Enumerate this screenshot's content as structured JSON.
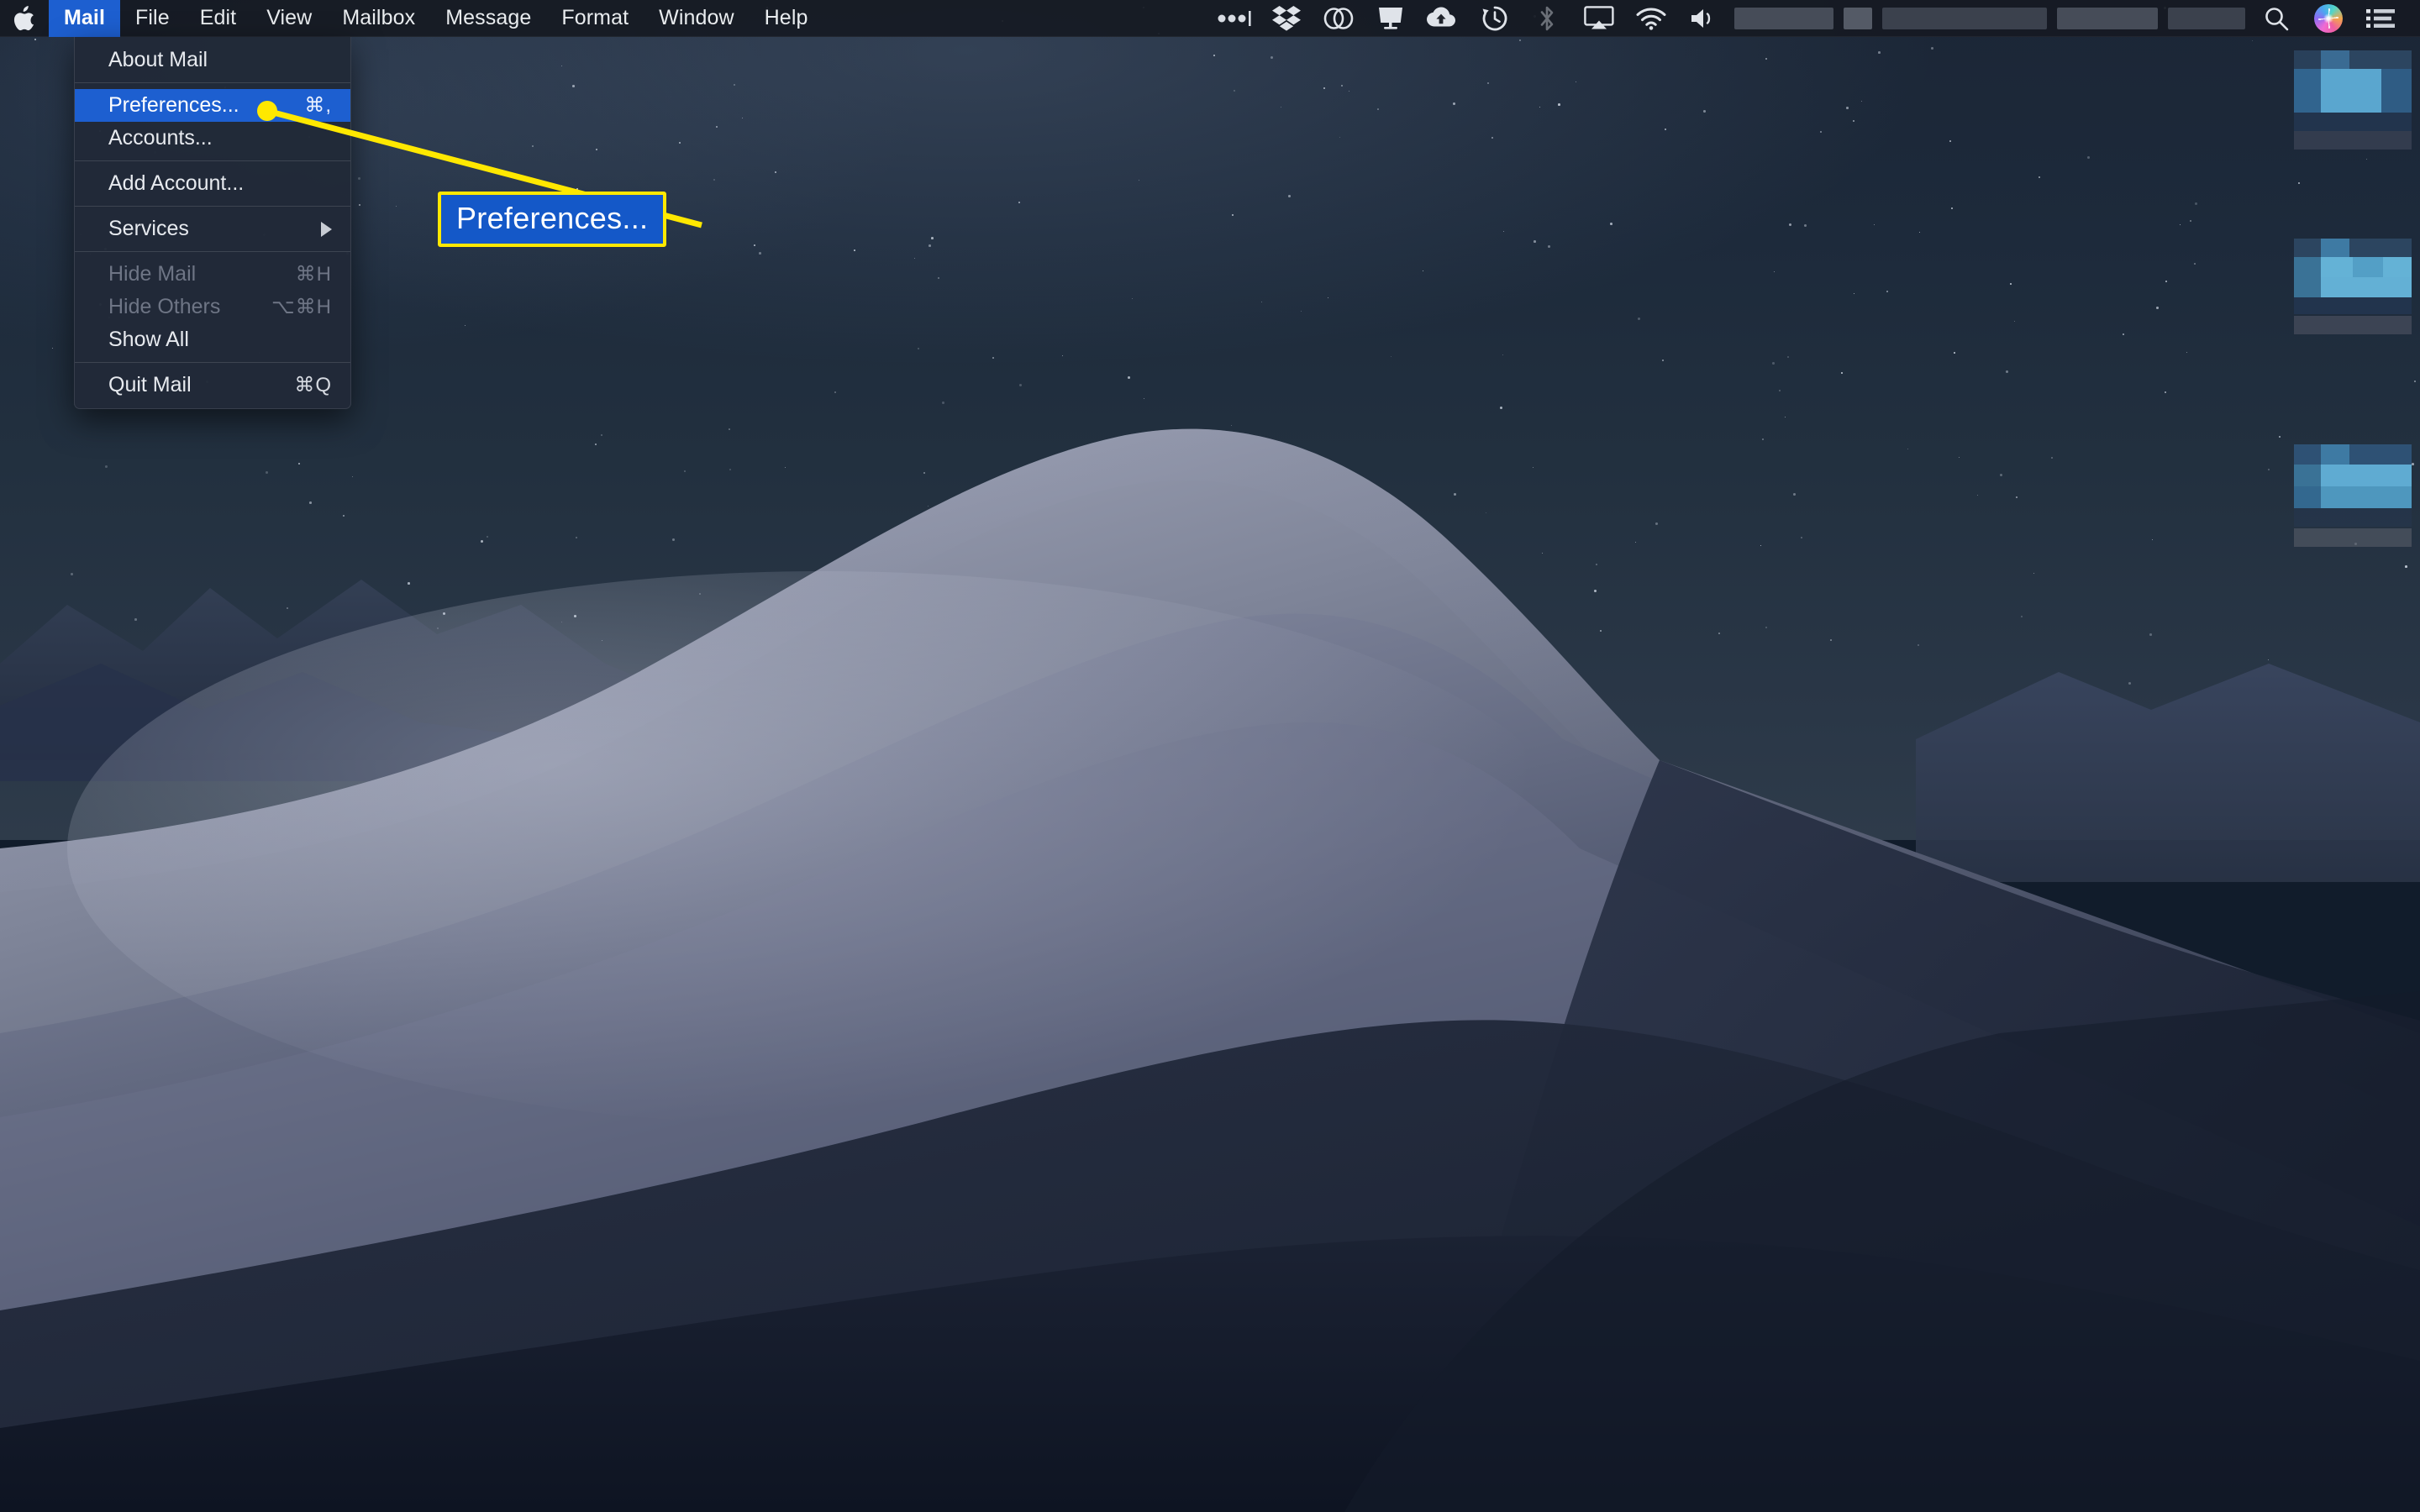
{
  "menubar": {
    "apple_icon": "apple-logo-icon",
    "items": [
      {
        "label": "Mail",
        "active": true
      },
      {
        "label": "File",
        "active": false
      },
      {
        "label": "Edit",
        "active": false
      },
      {
        "label": "View",
        "active": false
      },
      {
        "label": "Mailbox",
        "active": false
      },
      {
        "label": "Message",
        "active": false
      },
      {
        "label": "Format",
        "active": false
      },
      {
        "label": "Window",
        "active": false
      },
      {
        "label": "Help",
        "active": false
      }
    ],
    "status_icons": [
      {
        "name": "bartender-dots-icon",
        "dim": false
      },
      {
        "name": "dropbox-icon",
        "dim": false
      },
      {
        "name": "adobe-creative-cloud-icon",
        "dim": false
      },
      {
        "name": "display-screen-icon",
        "dim": false
      },
      {
        "name": "cloud-upload-icon",
        "dim": false
      },
      {
        "name": "time-machine-icon",
        "dim": false
      },
      {
        "name": "bluetooth-icon",
        "dim": true
      },
      {
        "name": "airplay-icon",
        "dim": false
      },
      {
        "name": "wifi-icon",
        "dim": false
      },
      {
        "name": "volume-icon",
        "dim": false
      }
    ],
    "redacted_blocks": [
      {
        "width": 118,
        "shade": "d1"
      },
      {
        "width": 34,
        "shade": "d3"
      },
      {
        "width": 196,
        "shade": "d2"
      },
      {
        "width": 120,
        "shade": "d1"
      },
      {
        "width": 92,
        "shade": "d2"
      }
    ],
    "right_icons": [
      {
        "name": "spotlight-search-icon"
      },
      {
        "name": "siri-icon"
      },
      {
        "name": "control-center-list-icon"
      }
    ]
  },
  "mail_menu": {
    "owner": "Mail",
    "groups": [
      {
        "items": [
          {
            "label": "About Mail",
            "shortcut": "",
            "state": "normal",
            "submenu": false
          }
        ]
      },
      {
        "items": [
          {
            "label": "Preferences...",
            "shortcut": "⌘,",
            "state": "selected",
            "submenu": false
          },
          {
            "label": "Accounts...",
            "shortcut": "",
            "state": "normal",
            "submenu": false
          }
        ]
      },
      {
        "items": [
          {
            "label": "Add Account...",
            "shortcut": "",
            "state": "normal",
            "submenu": false
          }
        ]
      },
      {
        "items": [
          {
            "label": "Services",
            "shortcut": "",
            "state": "normal",
            "submenu": true
          }
        ]
      },
      {
        "items": [
          {
            "label": "Hide Mail",
            "shortcut": "⌘H",
            "state": "disabled",
            "submenu": false
          },
          {
            "label": "Hide Others",
            "shortcut": "⌥⌘H",
            "state": "disabled",
            "submenu": false
          },
          {
            "label": "Show All",
            "shortcut": "",
            "state": "normal",
            "submenu": false
          }
        ]
      },
      {
        "items": [
          {
            "label": "Quit Mail",
            "shortcut": "⌘Q",
            "state": "normal",
            "submenu": false
          }
        ]
      }
    ]
  },
  "annotation": {
    "callout_label": "Preferences...",
    "line_color": "#ffe800",
    "box_fill": "#1458c8",
    "box_border": "#ffe800",
    "dot_target": "Preferences... menu item"
  },
  "desktop": {
    "wallpaper_name": "mojave-night-dune-wallpaper",
    "icons": [
      {
        "name": "desktop-icon-1",
        "label_redacted": true
      },
      {
        "name": "desktop-icon-2",
        "label_redacted": true
      },
      {
        "name": "desktop-icon-3",
        "label_redacted": true
      }
    ]
  },
  "colors": {
    "accent_blue": "#1d5fd0",
    "menubar_bg": "#161a22",
    "menu_bg": "#212938",
    "annotation_yellow": "#ffe800",
    "text_primary": "#e7eaef",
    "text_disabled": "#6e7585"
  }
}
